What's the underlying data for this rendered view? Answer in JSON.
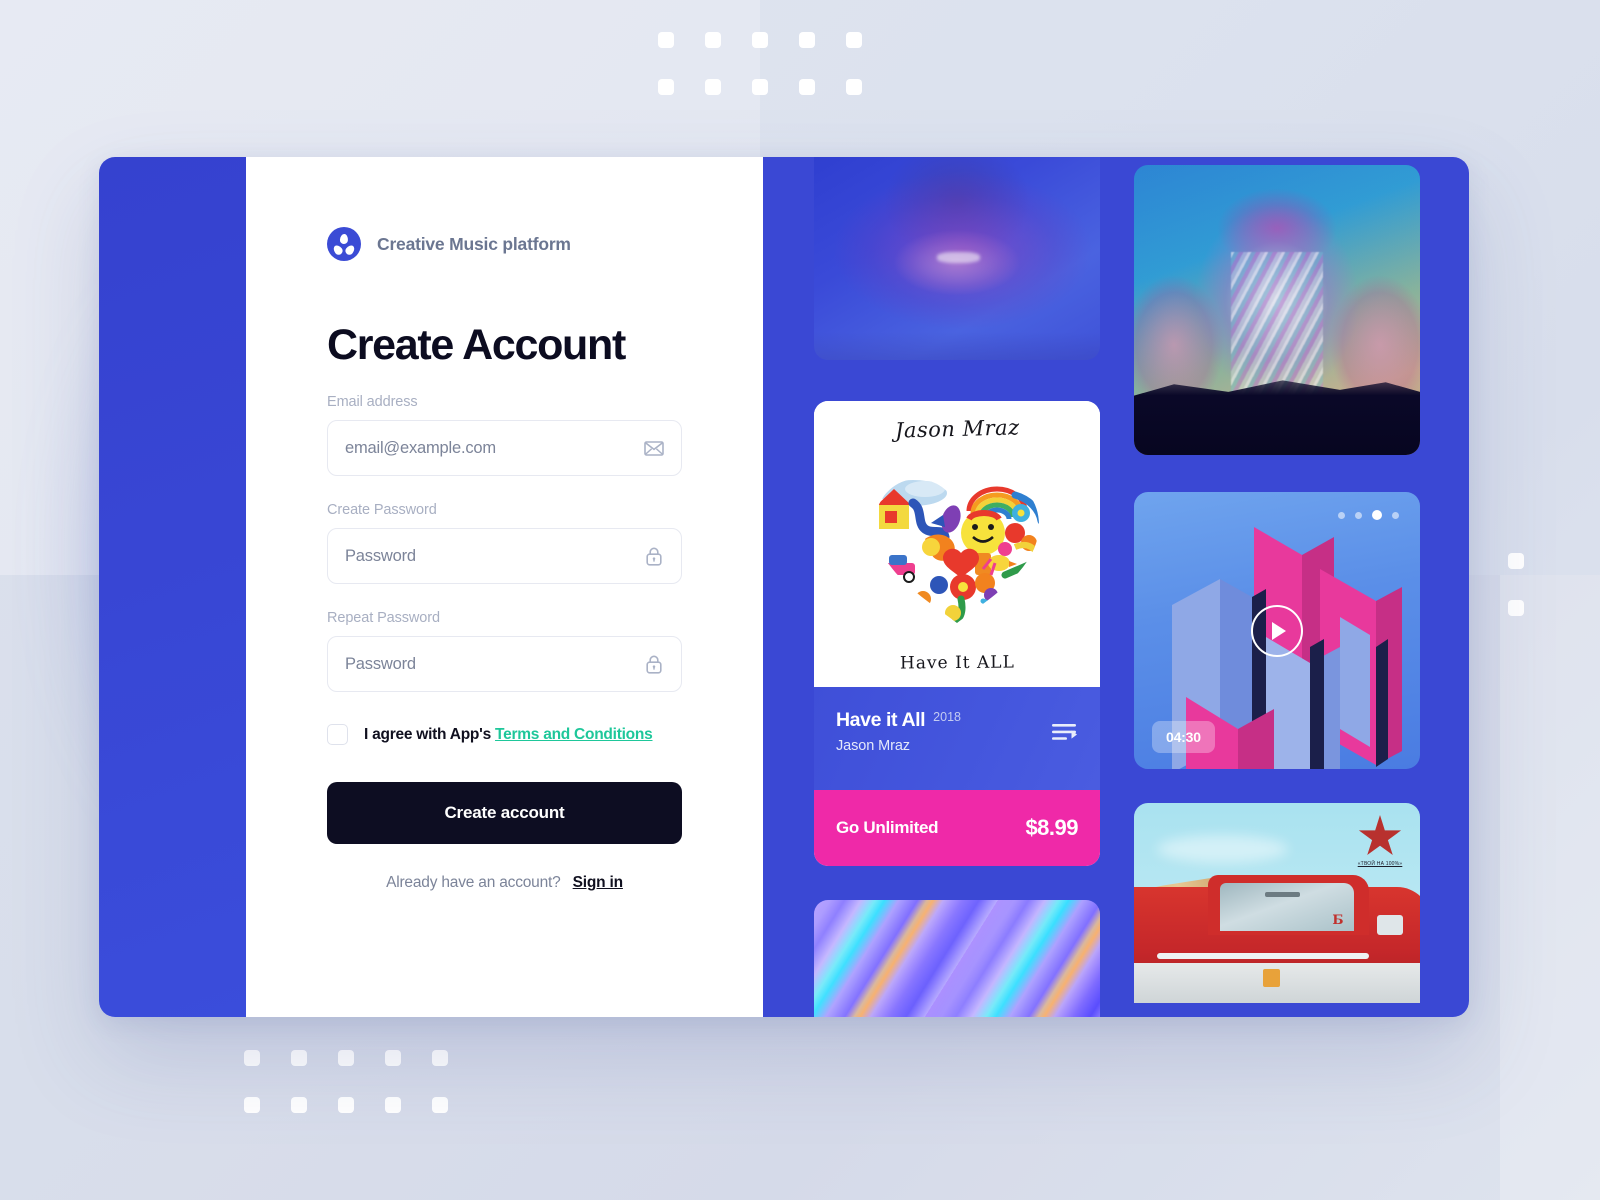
{
  "brand": {
    "name": "Creative Music platform",
    "logo_icon": "music-palette-logo-icon"
  },
  "form": {
    "title": "Create Account",
    "fields": [
      {
        "label": "Email address",
        "placeholder": "email@example.com",
        "value": "",
        "icon": "envelope-icon"
      },
      {
        "label": "Create Password",
        "placeholder": "Password",
        "value": "",
        "icon": "lock-icon"
      },
      {
        "label": "Repeat Password",
        "placeholder": "Password",
        "value": "",
        "icon": "lock-icon"
      }
    ],
    "terms": {
      "checked": false,
      "text": "I agree with App's",
      "link_label": "Terms and Conditions",
      "link_color": "#1ec79a"
    },
    "submit_label": "Create account",
    "footer_prompt": "Already have an account?",
    "signin_label": "Sign in"
  },
  "gallery": {
    "background_color": "#3a48d4",
    "tiles": [
      {
        "name": "smiling-person-photo",
        "caption": ""
      },
      {
        "name": "foil-portrait-photo",
        "caption": ""
      },
      {
        "name": "holographic-gradient-tile",
        "caption": ""
      },
      {
        "name": "truck-illustration-tile",
        "caption": ""
      }
    ],
    "album": {
      "art_artist_handwritten": "Jason Mraz",
      "art_title_handwritten": "Have It ALL",
      "title": "Have it All",
      "year": "2018",
      "artist": "Jason Mraz",
      "queue_icon": "playlist-queue-icon"
    },
    "promo": {
      "label": "Go Unlimited",
      "price": "$8.99",
      "color": "#ef29a8"
    },
    "video": {
      "duration": "04:30",
      "play_icon": "play-icon",
      "pager_total": 4,
      "pager_active": 3
    },
    "truck_badge_tagline": "«ТВОЙ НА 100%»",
    "truck_door_number": "Б"
  },
  "decor": {
    "dot_grid_rows": 2,
    "dot_grid_cols": 5,
    "dot_color": "#ffffff"
  }
}
